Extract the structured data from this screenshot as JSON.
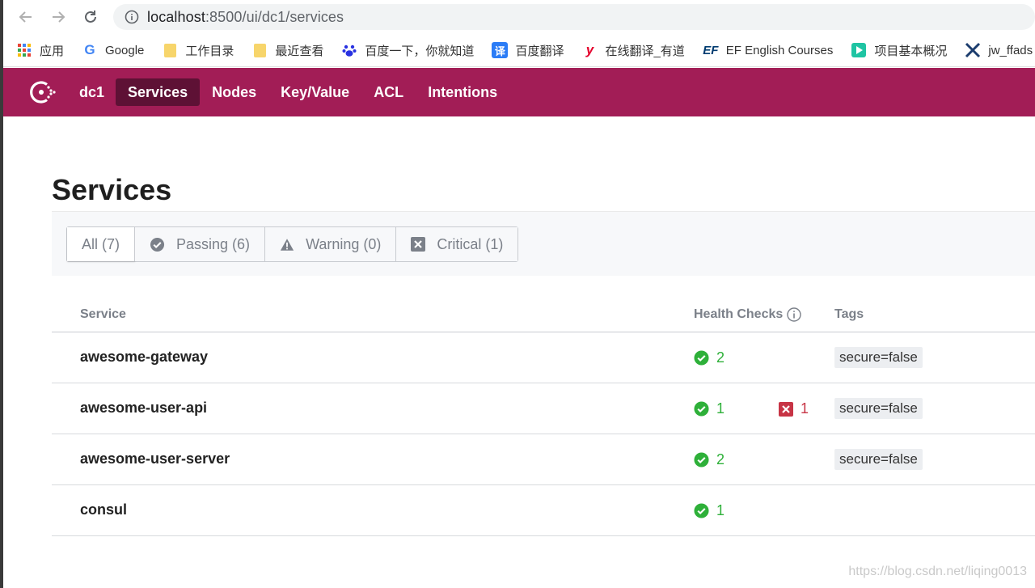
{
  "browser": {
    "url_host": "localhost",
    "url_path": ":8500/ui/dc1/services",
    "bookmarks": [
      {
        "label": "应用",
        "icon": "apps-grid-icon"
      },
      {
        "label": "Google",
        "icon": "google-icon"
      },
      {
        "label": "工作目录",
        "icon": "folder-icon"
      },
      {
        "label": "最近查看",
        "icon": "folder-icon"
      },
      {
        "label": "百度一下，你就知道",
        "icon": "baidu-icon"
      },
      {
        "label": "百度翻译",
        "icon": "translate-icon"
      },
      {
        "label": "在线翻译_有道",
        "icon": "youdao-icon"
      },
      {
        "label": "EF English Courses",
        "icon": "ef-icon"
      },
      {
        "label": "项目基本概况",
        "icon": "play-icon"
      },
      {
        "label": "jw_ffads",
        "icon": "x-icon"
      }
    ]
  },
  "header": {
    "dc": "dc1",
    "nav": [
      {
        "label": "Services",
        "active": true
      },
      {
        "label": "Nodes",
        "active": false
      },
      {
        "label": "Key/Value",
        "active": false
      },
      {
        "label": "ACL",
        "active": false
      },
      {
        "label": "Intentions",
        "active": false
      }
    ],
    "brand_color": "#a21d56"
  },
  "page": {
    "title": "Services",
    "filters": [
      {
        "label": "All (7)",
        "icon": "",
        "active": true
      },
      {
        "label": "Passing (6)",
        "icon": "check-circle-icon",
        "active": false
      },
      {
        "label": "Warning (0)",
        "icon": "warning-icon",
        "active": false
      },
      {
        "label": "Critical (1)",
        "icon": "x-square-icon",
        "active": false
      }
    ]
  },
  "table": {
    "columns": {
      "service": "Service",
      "health": "Health Checks",
      "tags": "Tags"
    },
    "rows": [
      {
        "name": "awesome-gateway",
        "passing": "2",
        "critical": "",
        "tag": "secure=false"
      },
      {
        "name": "awesome-user-api",
        "passing": "1",
        "critical": "1",
        "tag": "secure=false"
      },
      {
        "name": "awesome-user-server",
        "passing": "2",
        "critical": "",
        "tag": "secure=false"
      },
      {
        "name": "consul",
        "passing": "1",
        "critical": "",
        "tag": ""
      }
    ]
  },
  "colors": {
    "passing": "#2eb039",
    "critical": "#c73445"
  },
  "watermark": "https://blog.csdn.net/liqing0013"
}
